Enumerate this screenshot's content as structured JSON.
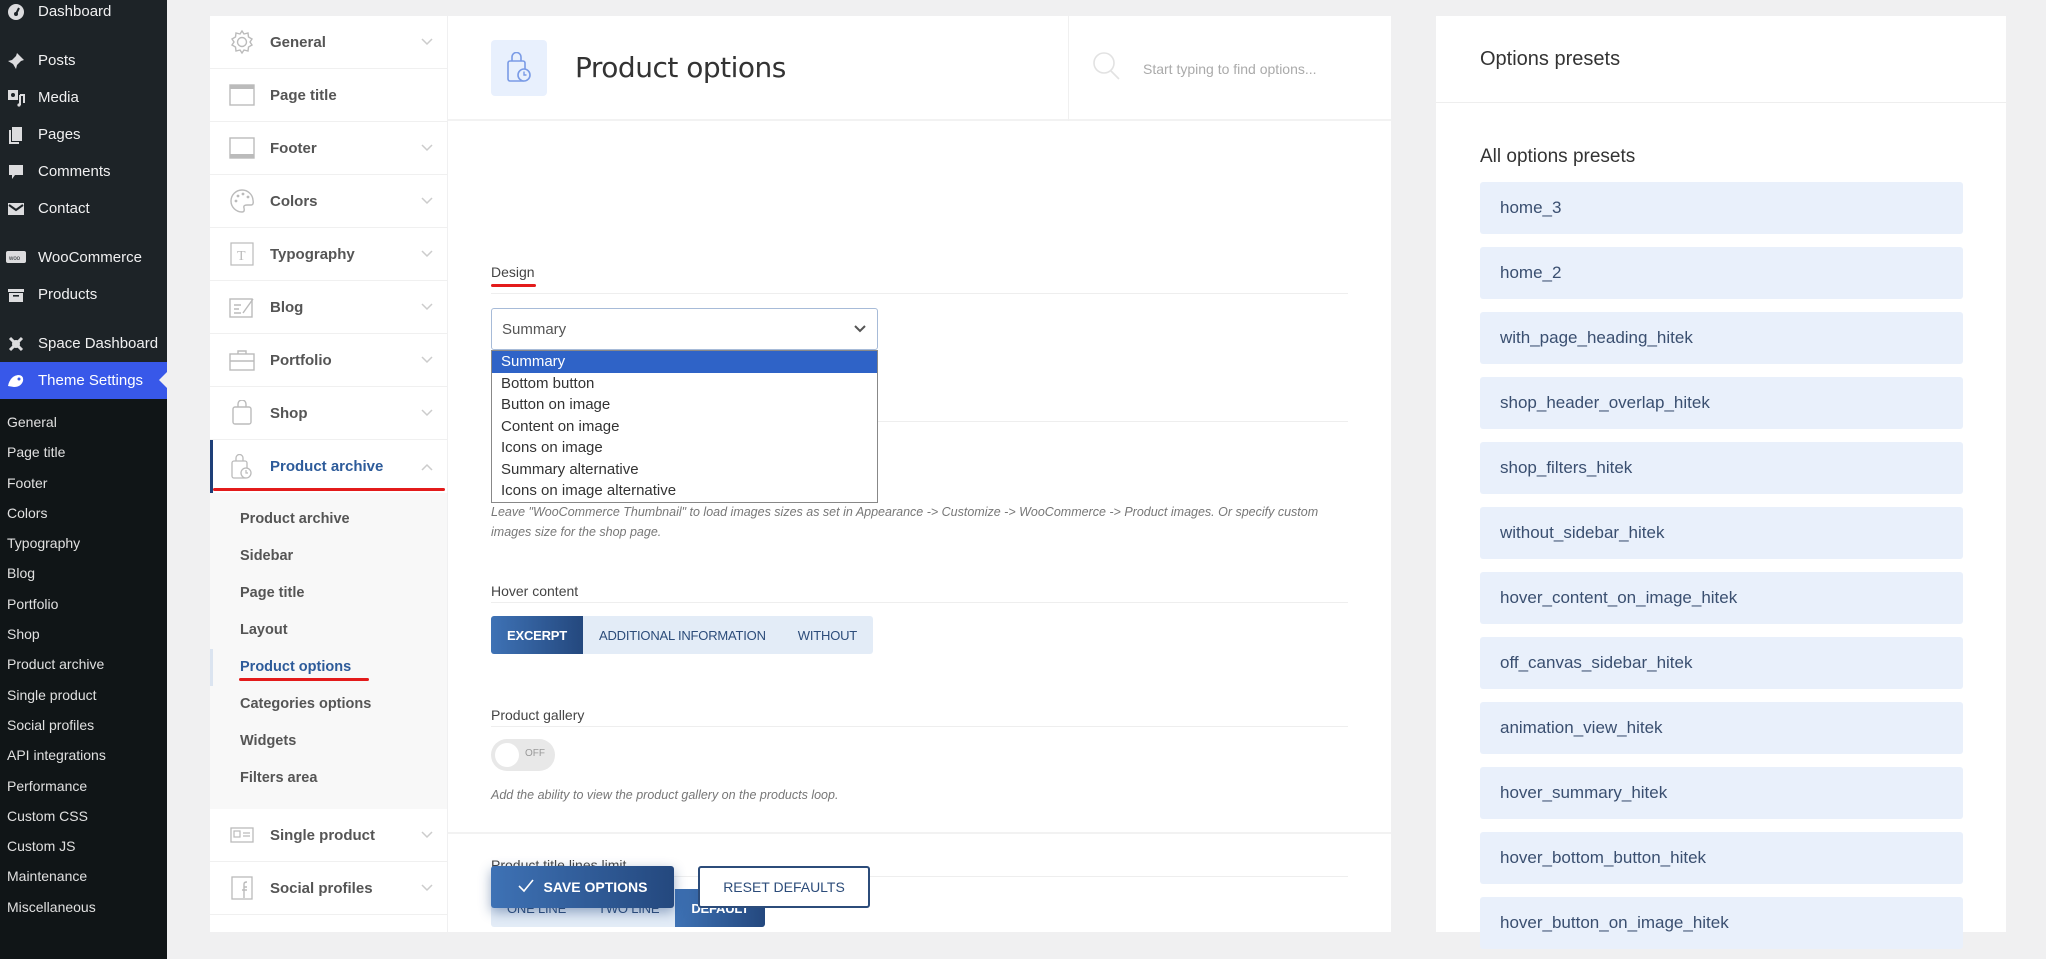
{
  "wp_menu": {
    "items": [
      {
        "label": "Dashboard",
        "icon": "dashboard-icon"
      },
      {
        "label": "Posts",
        "icon": "pin-icon"
      },
      {
        "label": "Media",
        "icon": "media-icon"
      },
      {
        "label": "Pages",
        "icon": "pages-icon"
      },
      {
        "label": "Comments",
        "icon": "comment-icon"
      },
      {
        "label": "Contact",
        "icon": "mail-icon"
      },
      {
        "label": "WooCommerce",
        "icon": "woo-icon"
      },
      {
        "label": "Products",
        "icon": "archive-box-icon"
      },
      {
        "label": "Space Dashboard",
        "icon": "cross-icon"
      },
      {
        "label": "Theme Settings",
        "icon": "theme-icon",
        "active": true
      }
    ],
    "submenu": [
      "General",
      "Page title",
      "Footer",
      "Colors",
      "Typography",
      "Blog",
      "Portfolio",
      "Shop",
      "Product archive",
      "Single product",
      "Social profiles",
      "API integrations",
      "Performance",
      "Custom CSS",
      "Custom JS",
      "Maintenance",
      "Miscellaneous"
    ]
  },
  "settings_nav": {
    "sections": [
      {
        "label": "General",
        "icon": "gear-icon",
        "chevron": true
      },
      {
        "label": "Page title",
        "icon": "page-title-icon",
        "chevron": false
      },
      {
        "label": "Footer",
        "icon": "footer-icon",
        "chevron": true
      },
      {
        "label": "Colors",
        "icon": "palette-icon",
        "chevron": true
      },
      {
        "label": "Typography",
        "icon": "typography-icon",
        "chevron": true
      },
      {
        "label": "Blog",
        "icon": "blog-icon",
        "chevron": true
      },
      {
        "label": "Portfolio",
        "icon": "briefcase-icon",
        "chevron": true
      },
      {
        "label": "Shop",
        "icon": "bag-icon",
        "chevron": true
      },
      {
        "label": "Product archive",
        "icon": "bag-clock-icon",
        "chevron": true,
        "open": true
      }
    ],
    "open_subitems": [
      "Product archive",
      "Sidebar",
      "Page title",
      "Layout",
      "Product options",
      "Categories options",
      "Widgets",
      "Filters area"
    ],
    "active_subitem": "Product options",
    "sections_after": [
      {
        "label": "Single product",
        "icon": "single-product-icon"
      },
      {
        "label": "Social profiles",
        "icon": "facebook-icon"
      }
    ]
  },
  "main": {
    "title": "Product options",
    "search_placeholder": "Start typing to find options...",
    "design": {
      "label": "Design",
      "selected": "Summary",
      "options": [
        "Summary",
        "Bottom button",
        "Button on image",
        "Content on image",
        "Icons on image",
        "Summary alternative",
        "Icons on image alternative"
      ]
    },
    "image_size_hint_line1": "Leave \"WooCommerce Thumbnail\" to load images sizes as set in Appearance -> Customize -> WooCommerce -> Product images. Or specify custom",
    "image_size_hint_line2": "images size for the shop page.",
    "hover_content": {
      "label": "Hover content",
      "options": [
        "EXCERPT",
        "ADDITIONAL INFORMATION",
        "WITHOUT"
      ],
      "selected": "EXCERPT"
    },
    "product_gallery": {
      "label": "Product gallery",
      "state": "OFF",
      "hint": "Add the ability to view the product gallery on the products loop."
    },
    "title_lines": {
      "label": "Product title lines limit",
      "options": [
        "ONE LINE",
        "TWO LINE",
        "DEFAULT"
      ],
      "selected": "DEFAULT"
    },
    "save_label": "SAVE OPTIONS",
    "reset_label": "RESET DEFAULTS"
  },
  "presets": {
    "title": "Options presets",
    "subtitle": "All options presets",
    "items": [
      "home_3",
      "home_2",
      "with_page_heading_hitek",
      "shop_header_overlap_hitek",
      "shop_filters_hitek",
      "without_sidebar_hitek",
      "hover_content_on_image_hitek",
      "off_canvas_sidebar_hitek",
      "animation_view_hitek",
      "hover_summary_hitek",
      "hover_bottom_button_hitek",
      "hover_button_on_image_hitek"
    ]
  },
  "colors": {
    "wp_active": "#3858e9",
    "accent": "#2d5b9a",
    "annotation_red": "#e31b1b",
    "select_highlight": "#2f63c7"
  }
}
